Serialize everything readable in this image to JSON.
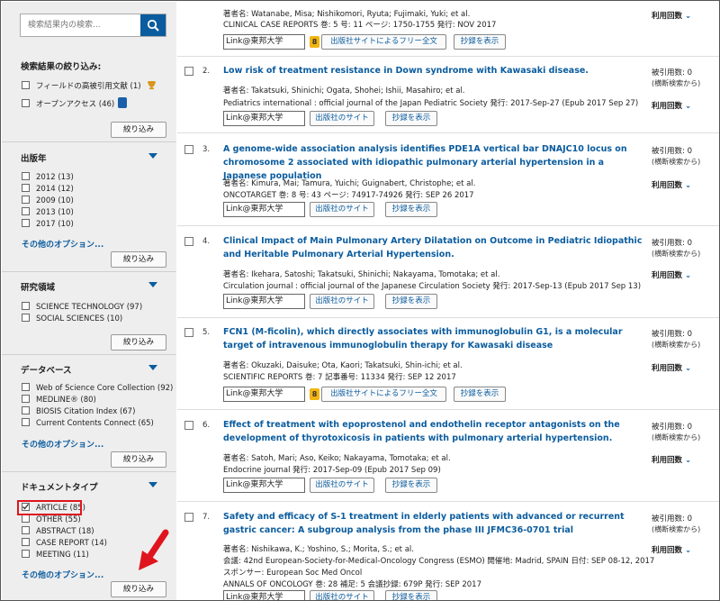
{
  "sidebar": {
    "search_placeholder": "検索結果内の検索...",
    "refine_title": "検索結果の絞り込み:",
    "refine_items": [
      {
        "label": "フィールドの高被引用文献 (1)"
      },
      {
        "label": "オープンアクセス (46)"
      }
    ],
    "apply_label": "絞り込み",
    "more_options": "その他のオプション...",
    "sections": [
      {
        "title": "出版年",
        "items": [
          "2012 (13)",
          "2014 (12)",
          "2009 (10)",
          "2013 (10)",
          "2017 (10)"
        ]
      },
      {
        "title": "研究領域",
        "items": [
          "SCIENCE TECHNOLOGY (97)",
          "SOCIAL SCIENCES (10)"
        ]
      },
      {
        "title": "データベース",
        "items": [
          "Web of Science Core Collection (92)",
          "MEDLINE® (80)",
          "BIOSIS Citation Index (67)",
          "Current Contents Connect (65)"
        ]
      },
      {
        "title": "ドキュメントタイプ",
        "items": [
          "ARTICLE (85)",
          "OTHER (55)",
          "ABSTRACT (18)",
          "CASE REPORT (14)",
          "MEETING (11)"
        ]
      }
    ]
  },
  "buttons": {
    "link_toho": "Link@東邦大学",
    "publisher_site": "出版社のサイト",
    "free_fulltext": "出版社サイトによるフリー全文",
    "abstract": "抄録を表示",
    "usage": "利用回数",
    "cited_by": "被引用数: 0",
    "cited_sub": "(横断検索から)"
  },
  "records": [
    {
      "num": "",
      "title": "",
      "lines": [
        "著者名: Watanabe, Misa; Nishikomori, Ryuta; Fujimaki, Yuki; et al.",
        "CLINICAL CASE REPORTS  巻: 5  号: 11  ページ: 1750-1755  発行: NOV 2017"
      ],
      "free": true
    },
    {
      "num": "2.",
      "title": "Low risk of treatment resistance in Down syndrome with Kawasaki disease.",
      "lines": [
        "著者名: Takatsuki, Shinichi; Ogata, Shohei; Ishii, Masahiro; et al.",
        "Pediatrics international : official journal of the Japan Pediatric Society    発行: 2017-Sep-27 (Epub 2017 Sep 27)"
      ],
      "free": false
    },
    {
      "num": "3.",
      "title": "A genome-wide association analysis identifies PDE1A vertical bar DNAJC10 locus on chromosome 2 associated with idiopathic pulmonary arterial hypertension in a Japanese population",
      "lines": [
        "著者名: Kimura, Mai; Tamura, Yuichi; Guignabert, Christophe; et al.",
        "ONCOTARGET  巻: 8  号: 43  ページ: 74917-74926  発行: SEP 26 2017"
      ],
      "free": false
    },
    {
      "num": "4.",
      "title": "Clinical Impact of Main Pulmonary Artery Dilatation on Outcome in Pediatric Idiopathic and Heritable Pulmonary Arterial Hypertension.",
      "lines": [
        "著者名: Ikehara, Satoshi; Takatsuki, Shinichi; Nakayama, Tomotaka; et al.",
        "Circulation journal : official journal of the Japanese Circulation Society    発行: 2017-Sep-13 (Epub 2017 Sep 13)"
      ],
      "free": false
    },
    {
      "num": "5.",
      "title": "FCN1 (M-ficolin), which directly associates with immunoglobulin G1, is a molecular target of intravenous immunoglobulin therapy for Kawasaki disease",
      "lines": [
        "著者名: Okuzaki, Daisuke; Ota, Kaori; Takatsuki, Shin-ichi; et al.",
        "SCIENTIFIC REPORTS  巻: 7   記事番号: 11334  発行: SEP 12 2017"
      ],
      "free": true
    },
    {
      "num": "6.",
      "title": "Effect of treatment with epoprostenol and endothelin receptor antagonists on the development of thyrotoxicosis in patients with pulmonary arterial hypertension.",
      "lines": [
        "著者名: Satoh, Mari; Aso, Keiko; Nakayama, Tomotaka; et al.",
        "Endocrine journal    発行: 2017-Sep-09 (Epub 2017 Sep 09)"
      ],
      "free": false
    },
    {
      "num": "7.",
      "title": "Safety and efficacy of S-1 treatment in elderly patients with advanced or recurrent gastric cancer: A subgroup analysis from the phase III JFMC36-0701 trial",
      "lines": [
        "著者名: Nishikawa, K.; Yoshino, S.; Morita, S.; et al.",
        "会議: 42nd European-Society-for-Medical-Oncology Congress (ESMO) 開催地: Madrid, SPAIN 日付: SEP 08-12, 2017",
        "スポンサー: European Soc Med Oncol",
        "ANNALS OF ONCOLOGY  巻: 28  補足: 5  会議抄録: 679P  発行: SEP 2017"
      ],
      "free": false
    }
  ]
}
